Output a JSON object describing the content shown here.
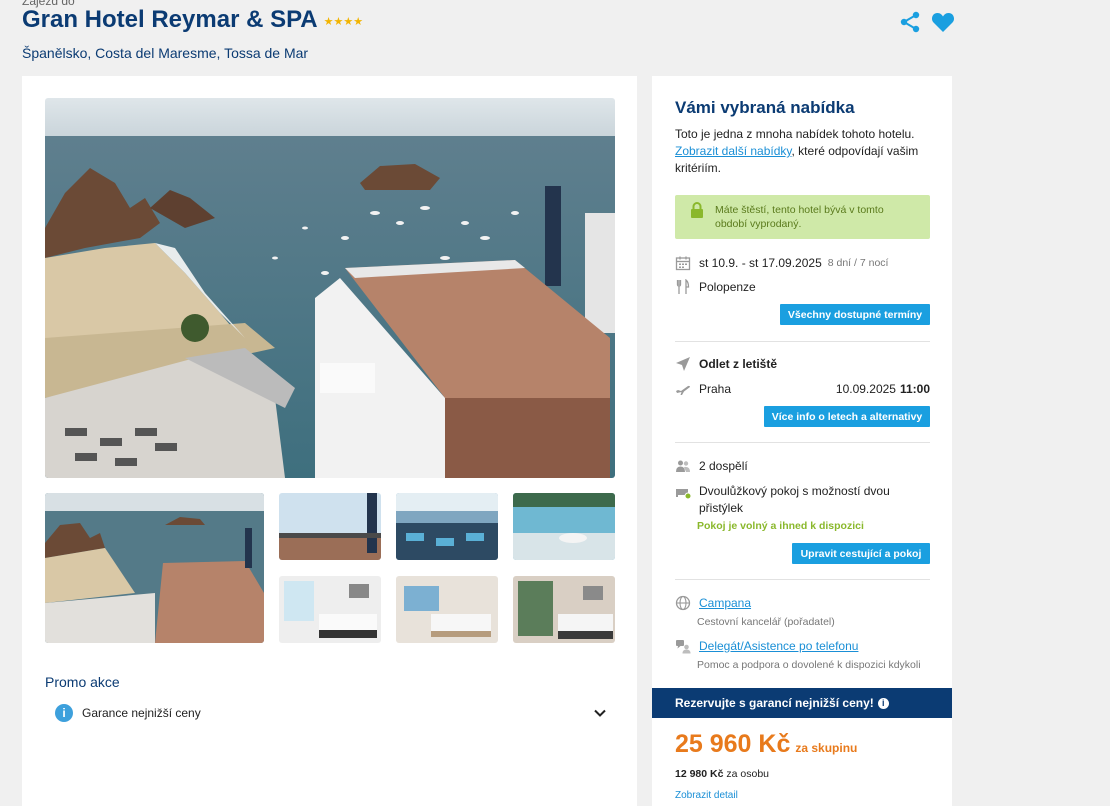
{
  "header": {
    "cut_top_text": "Zájezd do",
    "hotel_name": "Gran Hotel Reymar & SPA",
    "stars": "★★★★",
    "location": "Španělsko, Costa del Maresme, Tossa de Mar",
    "share_icon": "share-icon",
    "favorite_icon": "heart-icon",
    "accent_color": "#0b3b73",
    "icon_color": "#1a9fe0"
  },
  "gallery": {
    "main_photo": "hotel-terrace-sea-view",
    "thumbnails": [
      "beach-and-hotel-terrace",
      "rooftop-terrace-sky",
      "restaurant-sea-view",
      "pool-terrace",
      "bedroom-twin-beds",
      "room-sea-view",
      "room-balcony-view"
    ]
  },
  "promo": {
    "title": "Promo akce",
    "item_label": "Garance nejnižší ceny"
  },
  "offer": {
    "title": "Vámi vybraná nabídka",
    "intro": "Toto je jedna z mnoha nabídek tohoto hotelu.",
    "link": "Zobrazit další nabídky",
    "intro_rest": ", které odpovídají vašim kritériím.",
    "lucky_text": "Máte štěstí, tento hotel bývá v tomto období vyprodaný.",
    "dates": "st 10.9. - st 17.09.2025",
    "duration": "8 dní / 7 nocí",
    "board": "Polopenze",
    "all_dates_button": "Všechny dostupné termíny",
    "departure_title": "Odlet z letiště",
    "departure_city": "Praha",
    "departure_date": "10.09.2025",
    "departure_time": "11:00",
    "flights_button": "Více info o letech a alternativy",
    "travelers": "2 dospělí",
    "room_type": "Dvoulůžkový pokoj s možností dvou přistýlek",
    "room_status": "Pokoj je volný a ihned k dispozici",
    "edit_button": "Upravit cestující a pokoj",
    "agency_name": "Campana",
    "agency_sub": "Cestovní kancelář (pořadatel)",
    "delegate_name": "Delegát/Asistence po telefonu",
    "delegate_sub": "Pomoc a podpora o dovolené k dispozici kdykoli",
    "reserve_bar": "Rezervujte s garancí nejnižší ceny!",
    "price": "25 960 Kč",
    "price_unit": "za skupinu",
    "per_person_amount": "12 980 Kč",
    "per_person_label": "za osobu",
    "cut_bottom_text": "Zobrazit detail",
    "price_color": "#e87a1c",
    "button_color": "#1a9fe0",
    "success_color": "#8ab82c"
  }
}
